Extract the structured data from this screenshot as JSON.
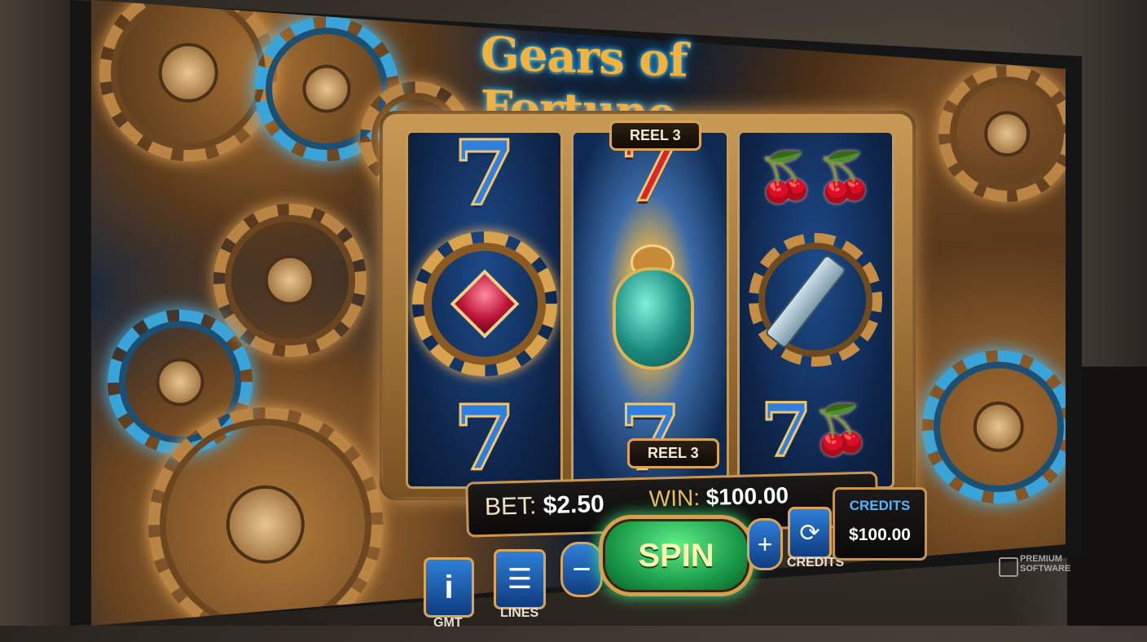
{
  "game": {
    "title": "Gears of Fortune",
    "reel_tag_top": "REEL 3",
    "reel_tag_bottom": "REEL 3"
  },
  "reels": [
    {
      "symbols": [
        "7",
        "gear-gem",
        "7"
      ],
      "highlighted": false
    },
    {
      "symbols": [
        "7",
        "scarab-beetle",
        "7"
      ],
      "highlighted": true
    },
    {
      "symbols": [
        "cherries",
        "key-gear",
        "7 + cherries"
      ],
      "highlighted": false
    }
  ],
  "betbar": {
    "bet_label": "BET:",
    "bet_value": "$2.50",
    "win_label": "WIN:",
    "win_value": "$100.00"
  },
  "controls": {
    "info_icon": "i",
    "info_caption": "GMT",
    "lines_caption": "LINES",
    "minus_label": "−",
    "spin_label": "SPIN",
    "plus_label": "+",
    "refresh_caption": "CREDITS"
  },
  "credits": {
    "title": "CREDITS",
    "value": "$100.00"
  },
  "brand": {
    "line1": "PREMIUM",
    "line2": "SOFTWARE"
  },
  "colors": {
    "accent_gold": "#d9a554",
    "spin_green": "#1a9a48",
    "reel_blue": "#0e2448"
  }
}
